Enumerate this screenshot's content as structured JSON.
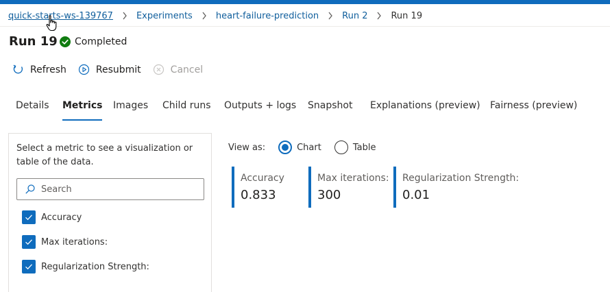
{
  "breadcrumb": {
    "items": [
      "quick-starts-ws-139767",
      "Experiments",
      "heart-failure-prediction",
      "Run 2"
    ],
    "current": "Run 19"
  },
  "header": {
    "title": "Run 19",
    "status": "Completed",
    "status_color": "#107c10"
  },
  "toolbar": {
    "refresh_label": "Refresh",
    "resubmit_label": "Resubmit",
    "cancel_label": "Cancel"
  },
  "tabs": [
    {
      "label": "Details",
      "active": false
    },
    {
      "label": "Metrics",
      "active": true
    },
    {
      "label": "Images",
      "active": false
    },
    {
      "label": "Child runs",
      "active": false
    },
    {
      "label": "Outputs + logs",
      "active": false
    },
    {
      "label": "Snapshot",
      "active": false
    },
    {
      "label": "Explanations (preview)",
      "active": false
    },
    {
      "label": "Fairness (preview)",
      "active": false
    }
  ],
  "metrics_panel": {
    "description": "Select a metric to see a visualization or table of the data.",
    "search_placeholder": "Search",
    "items": [
      {
        "label": "Accuracy",
        "checked": true
      },
      {
        "label": "Max iterations:",
        "checked": true
      },
      {
        "label": "Regularization Strength:",
        "checked": true
      }
    ]
  },
  "view_as": {
    "label": "View as:",
    "options": [
      {
        "label": "Chart",
        "selected": true
      },
      {
        "label": "Table",
        "selected": false
      }
    ]
  },
  "metric_cards": [
    {
      "label": "Accuracy",
      "value": "0.833"
    },
    {
      "label": "Max iterations:",
      "value": "300"
    },
    {
      "label": "Regularization Strength:",
      "value": "0.01"
    }
  ],
  "colors": {
    "accent": "#0f6cbd",
    "success": "#107c10"
  }
}
